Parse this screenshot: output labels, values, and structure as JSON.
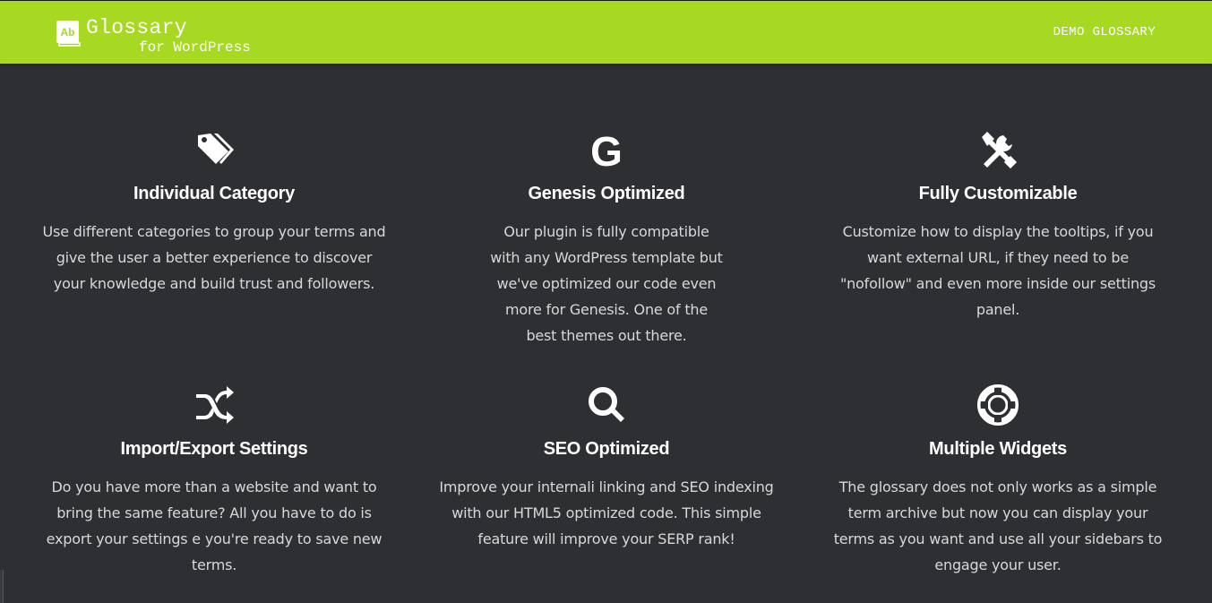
{
  "header": {
    "logo_icon_text": "Ab",
    "logo_title": "Glossary",
    "logo_subtitle": "for WordPress",
    "demo_link": "DEMO GLOSSARY"
  },
  "colors": {
    "header_bg": "#a8d922",
    "page_bg": "#2e2f33",
    "text": "#ffffff",
    "body_text": "#d8d8d8"
  },
  "features": [
    {
      "icon": "tags-icon",
      "title": "Individual Category",
      "text": "Use different categories to group your terms and give the user a better experience to discover your knowledge and build trust and followers."
    },
    {
      "icon": "genesis-g-icon",
      "icon_text": "G",
      "title": "Genesis Optimized",
      "text": "Our plugin is fully compatible with any WordPress template but we've optimized our code even more for Genesis. One of the best themes out there."
    },
    {
      "icon": "tools-icon",
      "title": "Fully Customizable",
      "text": "Customize how to display the tooltips, if you want external URL, if they need to be \"nofollow\" and even more inside our settings panel."
    },
    {
      "icon": "shuffle-icon",
      "title": "Import/Export Settings",
      "text": "Do you have more than a website and want to bring the same feature? All you have to do is export your settings e you're ready to save new terms."
    },
    {
      "icon": "search-icon",
      "title": "SEO Optimized",
      "text": "Improve your internali linking and SEO indexing with our HTML5 optimized code. This simple feature will improve your SERP rank!"
    },
    {
      "icon": "life-ring-icon",
      "title": "Multiple Widgets",
      "text": "The glossary does not only works as a simple term archive but now you can display your terms as you want and use all your sidebars to engage your user."
    }
  ]
}
